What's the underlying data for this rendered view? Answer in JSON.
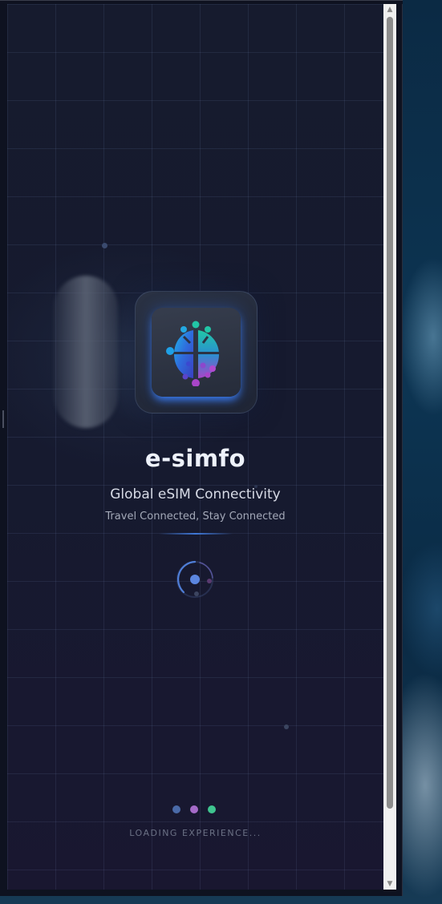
{
  "app": {
    "name": "e-simfo",
    "subtitle": "Global eSIM Connectivity",
    "tagline": "Travel Connected, Stay Connected",
    "loading_text": "LOADING EXPERIENCE..."
  },
  "icons": {
    "logo": "globe-dots-icon",
    "spinner": "loading-spinner-icon",
    "scroll_up": "scroll-up-arrow-icon",
    "scroll_down": "scroll-down-arrow-icon"
  },
  "colors": {
    "background": "#161b2e",
    "accent_blue": "#3f78d8",
    "dot_blue": "#4a6aa8",
    "dot_purple": "#a56bc8",
    "dot_green": "#3fc48f",
    "logo_teal": "#22c5a6",
    "logo_purple": "#a54ac9"
  },
  "scroll": {
    "up_glyph": "▲",
    "down_glyph": "▼"
  }
}
